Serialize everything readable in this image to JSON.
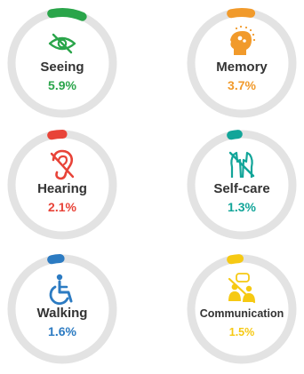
{
  "chart_data": {
    "type": "radial-progress",
    "title": "",
    "track_color": "#e3e3e3",
    "items": [
      {
        "name": "Seeing",
        "value": 5.9,
        "display": "5.9%",
        "color": "#2aa54a",
        "icon": "eye-slash-icon"
      },
      {
        "name": "Memory",
        "value": 3.7,
        "display": "3.7%",
        "color": "#f19a2b",
        "icon": "head-brain-icon"
      },
      {
        "name": "Hearing",
        "value": 2.1,
        "display": "2.1%",
        "color": "#e84338",
        "icon": "ear-slash-icon"
      },
      {
        "name": "Self-care",
        "value": 1.3,
        "display": "1.3%",
        "color": "#12a599",
        "icon": "hands-slash-icon"
      },
      {
        "name": "Walking",
        "value": 1.6,
        "display": "1.6%",
        "color": "#2c7bc2",
        "icon": "wheelchair-icon"
      },
      {
        "name": "Communication",
        "value": 1.5,
        "display": "1.5%",
        "color": "#f6c913",
        "icon": "speech-people-slash-icon"
      }
    ]
  }
}
